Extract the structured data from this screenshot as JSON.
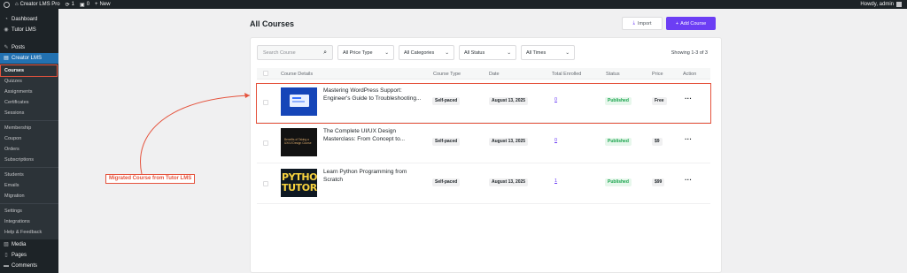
{
  "adminbar": {
    "site_name": "Creator LMS Pro",
    "updates_count": "1",
    "comments_count": "0",
    "new_label": "New",
    "howdy": "Howdy, admin"
  },
  "sidebar": {
    "top_items": [
      {
        "label": "Dashboard",
        "icon": "dashboard-icon"
      },
      {
        "label": "Tutor LMS",
        "icon": "tutor-icon"
      },
      {
        "label": "Posts",
        "icon": "pin-icon"
      },
      {
        "label": "Creator LMS",
        "icon": "creator-icon"
      }
    ],
    "submenu_group1": [
      "Courses",
      "Quizzes",
      "Assignments",
      "Certificates",
      "Sessions"
    ],
    "submenu_group2": [
      "Membership",
      "Coupon",
      "Orders",
      "Subscriptions"
    ],
    "submenu_group3": [
      "Students",
      "Emails",
      "Migration"
    ],
    "submenu_group4": [
      "Settings",
      "Integrations",
      "Help & Feedback"
    ],
    "bottom_items": [
      {
        "label": "Media",
        "icon": "media-icon"
      },
      {
        "label": "Pages",
        "icon": "pages-icon"
      },
      {
        "label": "Comments",
        "icon": "comments-icon"
      }
    ]
  },
  "page": {
    "title": "All Courses",
    "import_label": "Import",
    "add_label": "Add Course"
  },
  "filters": {
    "search_placeholder": "Search Course",
    "price_type": "All Price Type",
    "categories": "All Categories",
    "status": "All Status",
    "times": "All Times",
    "showing": "Showing 1-3 of 3"
  },
  "table": {
    "headers": {
      "details": "Course Details",
      "type": "Course Type",
      "date": "Date",
      "enrolled": "Total Enrolled",
      "status": "Status",
      "price": "Price",
      "action": "Action"
    },
    "rows": [
      {
        "title": "Mastering WordPress Support: Engineer's Guide to Troubleshooting...",
        "type": "Self-paced",
        "date": "August 13, 2025",
        "enrolled": "0",
        "status": "Published",
        "price": "Free"
      },
      {
        "title": "The Complete UI/UX Design Masterclass: From Concept to...",
        "type": "Self-paced",
        "date": "August 13, 2025",
        "enrolled": "0",
        "status": "Published",
        "price": "$9",
        "thumb_text": "Benefits of Taking a UX/UI Design Course"
      },
      {
        "title": "Learn Python Programming from Scratch",
        "type": "Self-paced",
        "date": "August 13, 2025",
        "enrolled": "1",
        "status": "Published",
        "price": "$99",
        "thumb_text": "PYTHON TUTORIAL"
      }
    ]
  },
  "annotation": {
    "callout": "Migrated Course from Tutor LMS",
    "color": "#e5533d"
  },
  "colors": {
    "accent": "#6c3ef4",
    "admin_blue": "#2271b1",
    "success": "#16a34a"
  }
}
